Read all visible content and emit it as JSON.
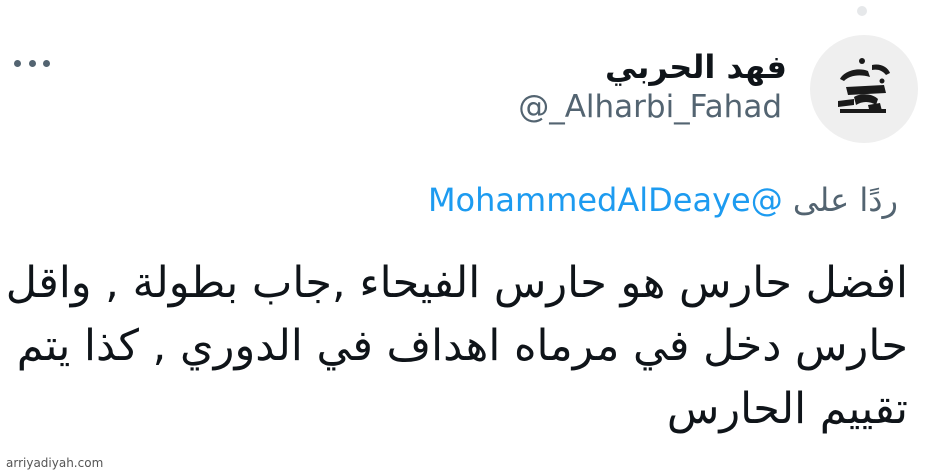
{
  "tweet": {
    "author": {
      "name": "فهد الحربي",
      "handle": "@_Alharbi_Fahad",
      "avatar_icon": "calligraphy-logo-avatar"
    },
    "more_icon": "more-dots-icon",
    "reply_to": {
      "label": "ردًا على",
      "user": "@MohammedAlDeaye"
    },
    "text_lines": [
      "افضل حارس هو حارس الفيحاء ,جاب بطولة , واقل",
      "حارس دخل في مرماه اهداف في الدوري , كذا يتم",
      "تقييم الحارس"
    ]
  },
  "watermark": "arriyadiyah.com",
  "colors": {
    "text": "#0f1419",
    "secondary": "#536471",
    "link": "#1d9bf0",
    "avatar_bg": "#efefef"
  }
}
